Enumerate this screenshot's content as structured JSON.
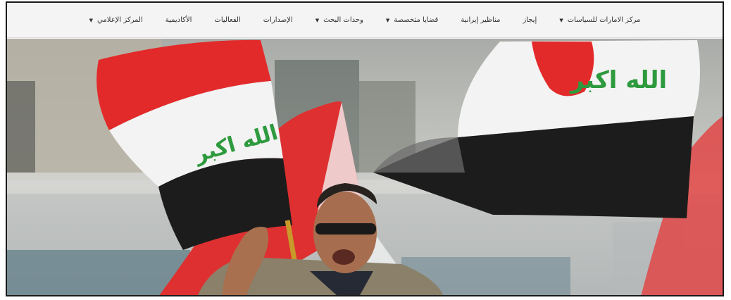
{
  "nav": {
    "items": [
      {
        "label": "مركز الامارات للسياسات",
        "dropdown": true
      },
      {
        "label": "إيجاز",
        "dropdown": false
      },
      {
        "label": "مناظير إيرانية",
        "dropdown": false
      },
      {
        "label": "قضايا متخصصة",
        "dropdown": true
      },
      {
        "label": "وحدات البحث",
        "dropdown": true
      },
      {
        "label": "الإصدارات",
        "dropdown": false
      },
      {
        "label": "الفعاليات",
        "dropdown": false
      },
      {
        "label": "الأكاديمية",
        "dropdown": false
      },
      {
        "label": "المركز الإعلامي",
        "dropdown": true
      }
    ],
    "caret_glyph": "▼"
  },
  "hero": {
    "flag_inscription": "الله اكبر",
    "colors": {
      "flag_red": "#e32a2a",
      "flag_white": "#f5f5f5",
      "flag_black": "#1c1c1c",
      "flag_green": "#2e9a3e"
    }
  }
}
